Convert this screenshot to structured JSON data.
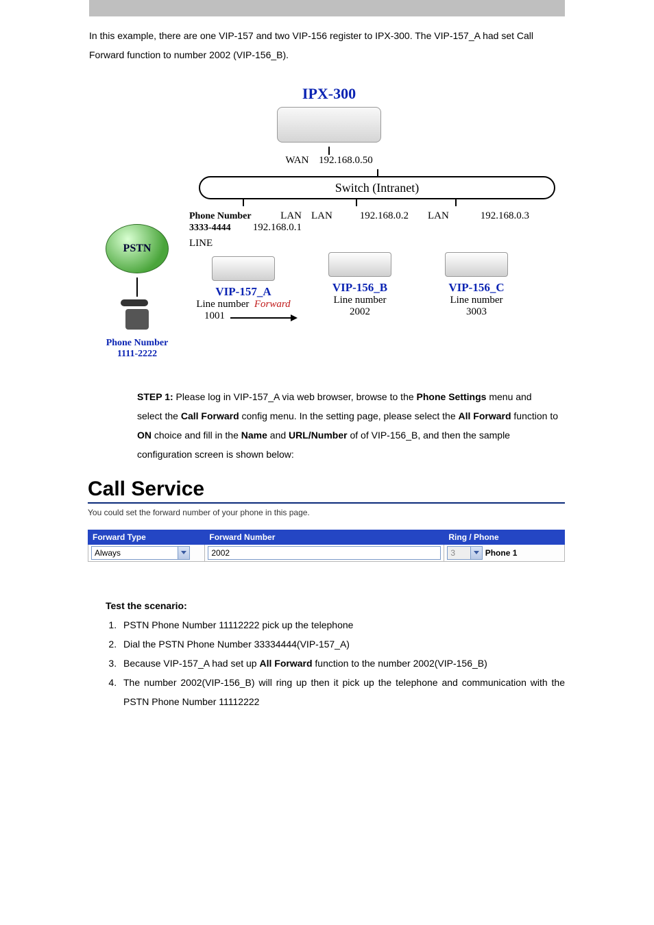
{
  "intro": "In this example, there are one VIP-157 and two VIP-156 register to IPX-300. The VIP-157_A had set Call Forward function to number 2002 (VIP-156_B).",
  "diagram": {
    "ipx_title": "IPX-300",
    "wan_label": "WAN",
    "wan_ip": "192.168.0.50",
    "switch_label": "Switch (Intranet)",
    "pstn_label": "PSTN",
    "pstn_phone_caption": "Phone Number",
    "pstn_phone_number": "1111-2222",
    "col_ph_label_top": "Phone Number",
    "col_ph_number_top": "3333-4444",
    "lan_label": "LAN",
    "line_label": "LINE",
    "ip_a": "192.168.0.1",
    "ip_b": "192.168.0.2",
    "ip_c": "192.168.0.3",
    "vip_a": "VIP-157_A",
    "vip_b": "VIP-156_B",
    "vip_c": "VIP-156_C",
    "line_num_label": "Line number",
    "num_a": "1001",
    "num_b": "2002",
    "num_c": "3003",
    "forward_label": "Forward"
  },
  "step": {
    "label": "STEP 1:",
    "l1a": "Please log in VIP-157_A via web browser, browse to the ",
    "l1b": "Phone Settings",
    "l1c": " menu and select the ",
    "l1d": "Call Forward",
    "l1e": " config menu. In the setting page, please select the ",
    "l1f": "All Forward",
    "l1g": " function to ",
    "l1h": "ON",
    "l1i": " choice and fill in the ",
    "l1j": "Name",
    "l1k": " and ",
    "l1l": "URL/Number",
    "l1m": " of of VIP-156_B, and then the sample configuration screen is shown below:"
  },
  "cs": {
    "heading": "Call Service",
    "sub": "You could set the forward number of your phone in this page.",
    "th1": "Forward Type",
    "th2": "Forward Number",
    "th3": "Ring / Phone",
    "type_value": "Always",
    "number_value": "2002",
    "ring_value": "3",
    "phone_value": "Phone 1"
  },
  "test": {
    "heading": "Test the scenario:",
    "s1": "PSTN Phone Number 11112222 pick up the telephone",
    "s2": "Dial the PSTN Phone Number 33334444(VIP-157_A)",
    "s3a": "Because VIP-157_A had set up ",
    "s3b": "All Forward",
    "s3c": " function to the number 2002(VIP-156_B)",
    "s4": "The number 2002(VIP-156_B) will ring up then it pick up the telephone and communication with the PSTN Phone Number 11112222"
  }
}
